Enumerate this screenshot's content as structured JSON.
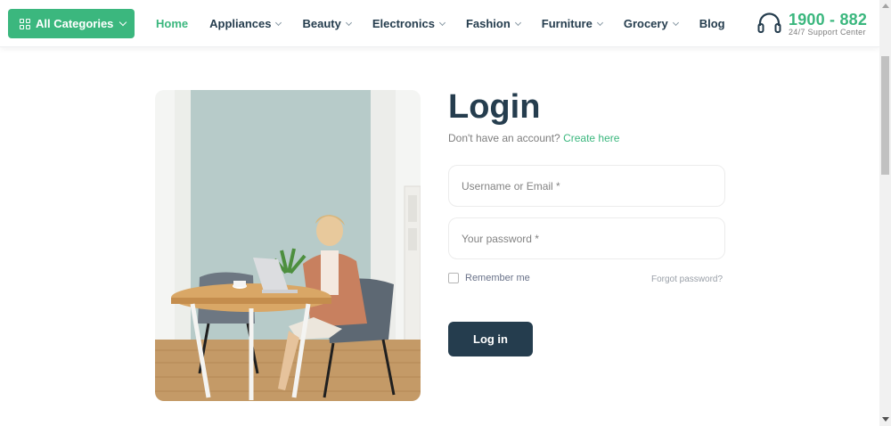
{
  "header": {
    "categories_button": "All Categories",
    "nav": [
      {
        "label": "Home",
        "active": true,
        "dropdown": false
      },
      {
        "label": "Appliances",
        "active": false,
        "dropdown": true
      },
      {
        "label": "Beauty",
        "active": false,
        "dropdown": true
      },
      {
        "label": "Electronics",
        "active": false,
        "dropdown": true
      },
      {
        "label": "Fashion",
        "active": false,
        "dropdown": true
      },
      {
        "label": "Furniture",
        "active": false,
        "dropdown": true
      },
      {
        "label": "Grocery",
        "active": false,
        "dropdown": true
      },
      {
        "label": "Blog",
        "active": false,
        "dropdown": false
      }
    ],
    "support": {
      "phone": "1900 - 882",
      "subtitle": "24/7 Support Center",
      "icon": "headset-icon"
    }
  },
  "login": {
    "title": "Login",
    "no_account_text": "Don't have an account?",
    "create_link": "Create here",
    "username_placeholder": "Username or Email *",
    "password_placeholder": "Your password *",
    "remember_label": "Remember me",
    "forgot_link": "Forgot password?",
    "submit_label": "Log in"
  },
  "colors": {
    "brand_green": "#3bb77e",
    "heading_dark": "#253d4e"
  }
}
